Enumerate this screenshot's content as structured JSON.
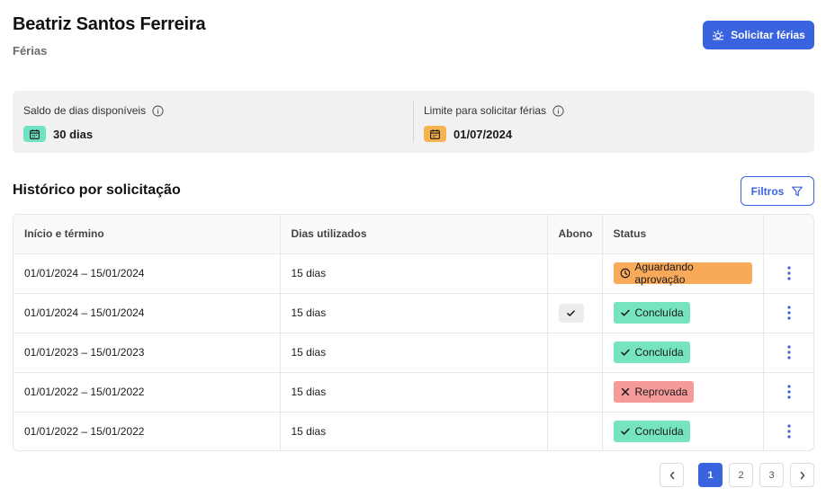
{
  "header": {
    "user_name": "Beatriz Santos Ferreira",
    "subtitle": "Férias",
    "request_button_label": "Solicitar férias"
  },
  "balance": {
    "available_label": "Saldo de dias disponíveis",
    "available_value": "30 dias",
    "limit_label": "Limite para solicitar férias",
    "limit_value": "01/07/2024"
  },
  "history": {
    "title": "Histórico por solicitação",
    "filter_label": "Filtros",
    "columns": {
      "period": "Início e término",
      "days_used": "Dias utilizados",
      "abono": "Abono",
      "status": "Status"
    },
    "rows": [
      {
        "period": "01/01/2024 – 15/01/2024",
        "days": "15 dias",
        "abono": false,
        "status": "Aguardando aprovação",
        "status_kind": "pending"
      },
      {
        "period": "01/01/2024 – 15/01/2024",
        "days": "15 dias",
        "abono": true,
        "status": "Concluída",
        "status_kind": "done"
      },
      {
        "period": "01/01/2023 – 15/01/2023",
        "days": "15 dias",
        "abono": false,
        "status": "Concluída",
        "status_kind": "done"
      },
      {
        "period": "01/01/2022 – 15/01/2022",
        "days": "15 dias",
        "abono": false,
        "status": "Reprovada",
        "status_kind": "rejected"
      },
      {
        "period": "01/01/2022 – 15/01/2022",
        "days": "15 dias",
        "abono": false,
        "status": "Concluída",
        "status_kind": "done"
      }
    ]
  },
  "pagination": {
    "pages": [
      "1",
      "2",
      "3"
    ],
    "current": "1"
  },
  "colors": {
    "primary": "#3a63e0",
    "pending": "#f8a95a",
    "done": "#76e3c1",
    "rejected": "#f69a9a",
    "balance_chip": "#6fe3c1",
    "limit_chip": "#f7b24d"
  },
  "icons": {
    "request_button": "sun-icon",
    "info": "info-icon",
    "balance": "calendar-icon",
    "filter": "filter-funnel-icon",
    "pending": "clock-icon",
    "done": "check-icon",
    "rejected": "x-icon",
    "row_menu": "kebab-menu-icon",
    "prev": "chevron-left-icon",
    "next": "chevron-right-icon"
  }
}
